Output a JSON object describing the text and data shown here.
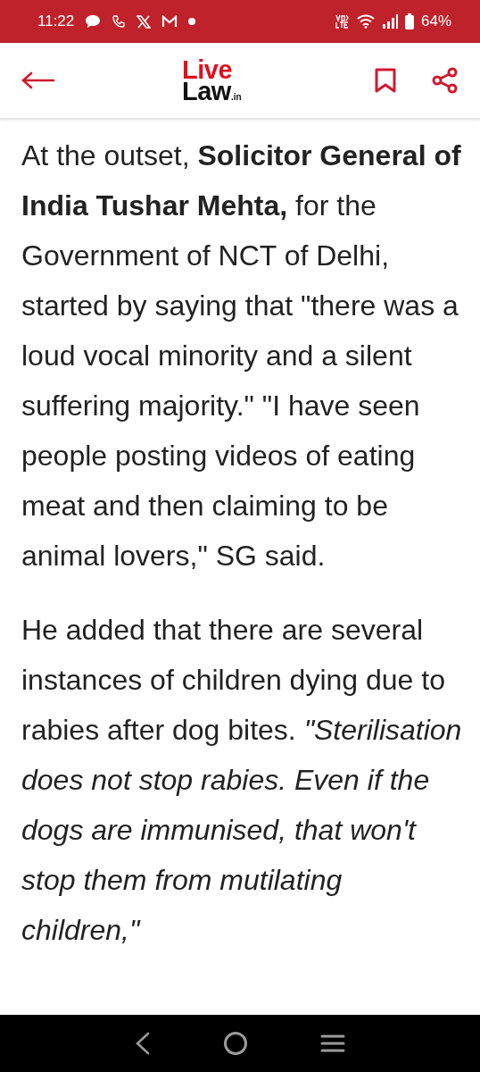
{
  "status_bar": {
    "time": "11:22",
    "battery": "64%"
  },
  "app_bar": {
    "logo": {
      "line_1": "Live",
      "line_2": "Law",
      ".suffix": ".in"
    }
  },
  "article": {
    "paragraphs": [
      "At the outset, **Solicitor General of India Tushar Mehta,** for the Government of NCT of Delhi, started by saying that \"there was a loud vocal minority and a silent suffering majority.\" \"I have seen people posting videos of eating meat and then claiming to be animal lovers,\" SG said.",
      "He added that there are several instances of children dying due to rabies after dog bites. *\"Sterilisation does not stop rabies. Even if the dogs are immunised, that won't stop them from mutilating children,\"*"
    ]
  }
}
